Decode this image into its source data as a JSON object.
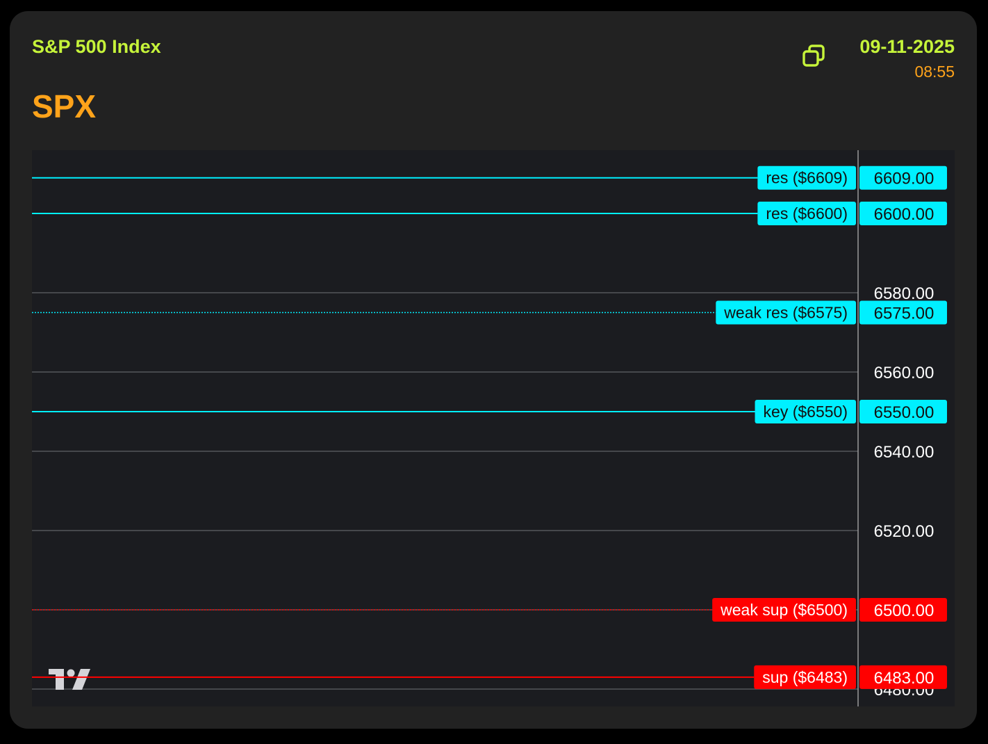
{
  "header": {
    "name": "S&P 500 Index",
    "ticker": "SPX",
    "date": "09-11-2025",
    "time": "08:55",
    "copy_icon": "copy-icon"
  },
  "colors": {
    "background": "#222222",
    "chart_background": "#1b1c20",
    "name": "#c6f43a",
    "ticker": "#ffa31a",
    "resistance": "#00f0ff",
    "support": "#ff0000",
    "grid": "#55565a",
    "axis_text": "#ffffff"
  },
  "chart_data": {
    "type": "line",
    "y_axis": {
      "ticks": [
        6580,
        6560,
        6540,
        6520,
        6500,
        6480
      ],
      "tick_labels": [
        "6580.00",
        "6560.00",
        "6540.00",
        "6520.00",
        "6480.00"
      ],
      "visible_range": [
        6476,
        6616
      ]
    },
    "levels": [
      {
        "label": "res ($6609)",
        "price": 6609,
        "price_label": "6609.00",
        "kind": "resistance",
        "style": "solid"
      },
      {
        "label": "res ($6600)",
        "price": 6600,
        "price_label": "6600.00",
        "kind": "resistance",
        "style": "solid"
      },
      {
        "label": "weak res ($6575)",
        "price": 6575,
        "price_label": "6575.00",
        "kind": "resistance",
        "style": "dotted"
      },
      {
        "label": "key ($6550)",
        "price": 6550,
        "price_label": "6550.00",
        "kind": "key",
        "style": "solid"
      },
      {
        "label": "weak sup ($6500)",
        "price": 6500,
        "price_label": "6500.00",
        "kind": "support",
        "style": "dotted"
      },
      {
        "label": "sup ($6483)",
        "price": 6483,
        "price_label": "6483.00",
        "kind": "support",
        "style": "solid"
      }
    ],
    "watermark": "tradingview-logo"
  }
}
